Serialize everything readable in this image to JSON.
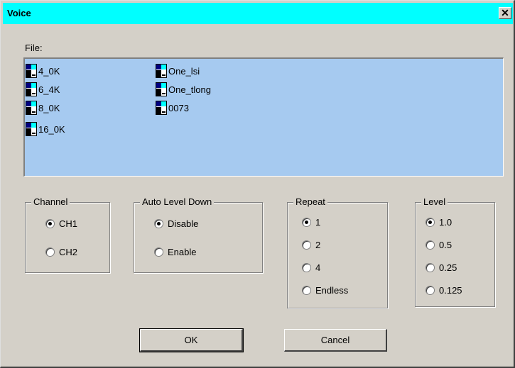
{
  "window": {
    "title": "Voice",
    "close_glyph": "✕"
  },
  "file": {
    "label": "File:",
    "items": [
      {
        "name": "4_0K",
        "icon": "file-icon"
      },
      {
        "name": "6_4K",
        "icon": "file-icon"
      },
      {
        "name": "8_0K",
        "icon": "file-icon"
      },
      {
        "name": "16_0K",
        "icon": "file-icon"
      },
      {
        "name": "One_lsi",
        "icon": "file-icon"
      },
      {
        "name": "One_tlong",
        "icon": "file-icon"
      },
      {
        "name": "0073",
        "icon": "file-icon"
      }
    ]
  },
  "channel": {
    "title": "Channel",
    "options": [
      {
        "label": "CH1",
        "checked": true
      },
      {
        "label": "CH2",
        "checked": false
      }
    ]
  },
  "auto_level_down": {
    "title": "Auto Level Down",
    "options": [
      {
        "label": "Disable",
        "checked": true
      },
      {
        "label": "Enable",
        "checked": false
      }
    ]
  },
  "repeat": {
    "title": "Repeat",
    "options": [
      {
        "label": "1",
        "checked": true
      },
      {
        "label": "2",
        "checked": false
      },
      {
        "label": "4",
        "checked": false
      },
      {
        "label": "Endless",
        "checked": false
      }
    ]
  },
  "level": {
    "title": "Level",
    "options": [
      {
        "label": "1.0",
        "checked": true
      },
      {
        "label": "0.5",
        "checked": false
      },
      {
        "label": "0.25",
        "checked": false
      },
      {
        "label": "0.125",
        "checked": false
      }
    ]
  },
  "buttons": {
    "ok": "OK",
    "cancel": "Cancel"
  },
  "colors": {
    "title_bar": "#00ffff",
    "list_background": "#a6caf0",
    "dialog_face": "#d4d0c8"
  }
}
